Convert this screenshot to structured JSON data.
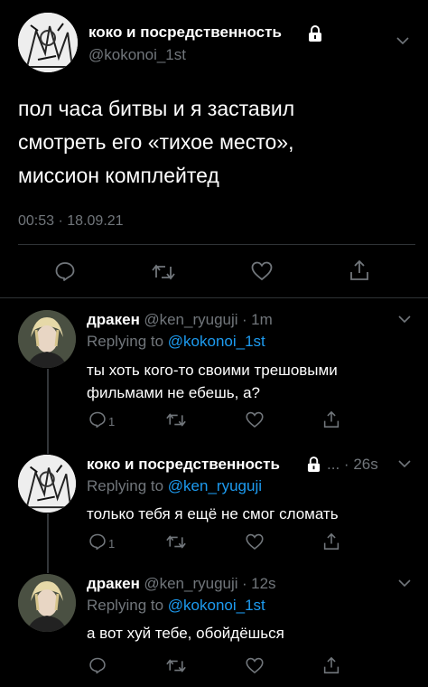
{
  "main_tweet": {
    "display_name": "коко и посредственность",
    "handle": "@kokonoi_1st",
    "text_lines": [
      "пол часа битвы и я заставил",
      "смотреть его «тихое место»,",
      "миссион комплейтед"
    ],
    "time": "00:53",
    "date": "18.09.21"
  },
  "replies": [
    {
      "display_name": "дракен",
      "handle": "@ken_ryuguji",
      "age": "1m",
      "replying_label": "Replying to",
      "replying_to": "@kokonoi_1st",
      "text_lines": [
        "ты хоть кого-то своими трешовыми",
        "фильмами не ебешь, а?"
      ],
      "reply_count": "1"
    },
    {
      "display_name": "коко и посредственность",
      "handle_truncated": "...",
      "age": "26s",
      "replying_label": "Replying to",
      "replying_to": "@ken_ryuguji",
      "text_lines": [
        "только тебя я ещё не смог сломать"
      ],
      "reply_count": "1"
    },
    {
      "display_name": "дракен",
      "handle": "@ken_ryuguji",
      "age": "12s",
      "replying_label": "Replying to",
      "replying_to": "@kokonoi_1st",
      "text_lines": [
        "а вот хуй тебе, обойдёшься"
      ]
    }
  ],
  "icons": {
    "reply": "reply-icon",
    "retweet": "retweet-icon",
    "like": "heart-icon",
    "share": "share-icon",
    "lock": "lock-icon",
    "chevron": "chevron-down-icon"
  },
  "colors": {
    "accent": "#1d9bf0",
    "muted": "#71767b",
    "background": "#000000"
  }
}
